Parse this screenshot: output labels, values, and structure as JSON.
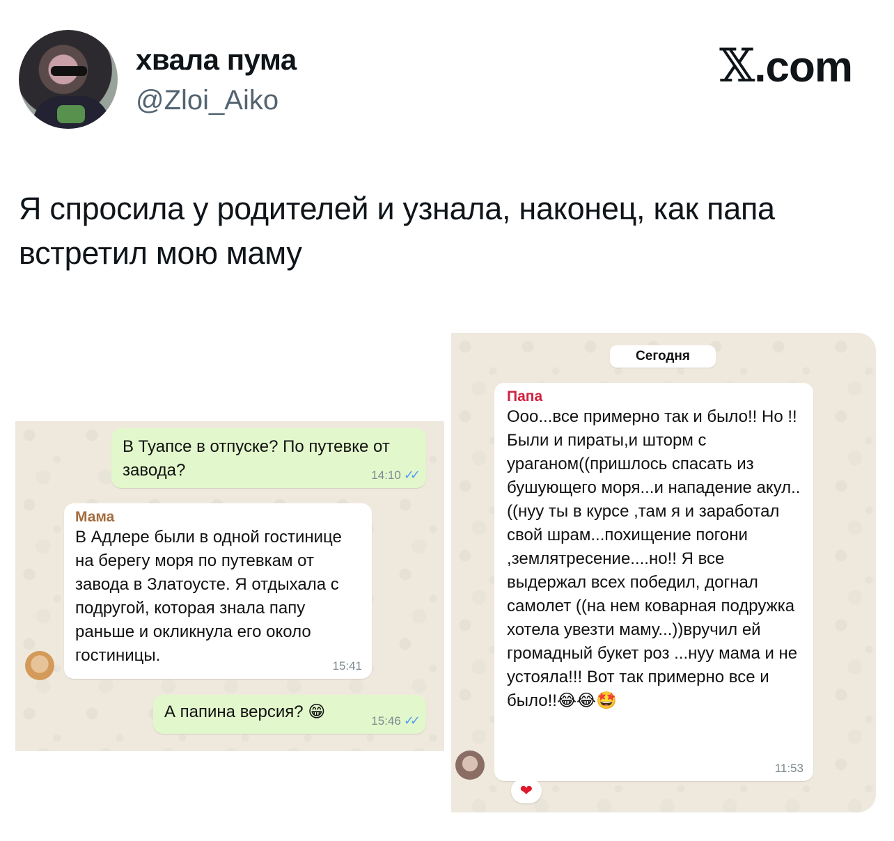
{
  "author": {
    "display_name": "хвала пума",
    "handle": "@Zloi_Aiko"
  },
  "brand": {
    "logo_mark": "𝕏",
    "domain": ".com"
  },
  "tweet": {
    "text": "Я спросила у родителей и узнала, наконец, как папа встретил мою маму"
  },
  "chat_left": {
    "messages": [
      {
        "direction": "outgoing",
        "text": "В Туапсе в отпуске? По путевке от завода?",
        "time": "14:10",
        "ticks": "✓✓"
      },
      {
        "direction": "incoming",
        "sender": "Мама",
        "sender_color": "#a36b3c",
        "text": "В Адлере были в одной гостинице на берегу моря по путевкам от завода в Златоусте. Я отдыхала с подругой, которая знала папу раньше и окликнула его около гостиницы.",
        "time": "15:41"
      },
      {
        "direction": "outgoing",
        "text": "А папина версия? 😁",
        "time": "15:46",
        "ticks": "✓✓"
      }
    ]
  },
  "chat_right": {
    "date_label": "Сегодня",
    "messages": [
      {
        "direction": "incoming",
        "sender": "Папа",
        "sender_color": "#d1203e",
        "text": "Ооо...все примерно так и было!! Но !! Были и пираты,и шторм с ураганом((пришлось спасать из бушующего моря...и нападение акул..((нуу ты в курсе ,там я и заработал свой шрам...похищение погони ,землятресение....но!! Я все выдержал всех победил, догнал самолет ((на нем коварная подружка хотела увезти маму...))вручил ей громадный букет роз ...нуу мама и не устояла!!! Вот так примерно все и было!!😂😂🤩",
        "time": "11:53",
        "reaction": "❤"
      }
    ]
  },
  "colors": {
    "outgoing_bubble": "#e2f7cb",
    "incoming_bubble": "#ffffff",
    "wallpaper": "#efe9dd",
    "read_ticks": "#4f9cf0",
    "handle_gray": "#536471"
  }
}
